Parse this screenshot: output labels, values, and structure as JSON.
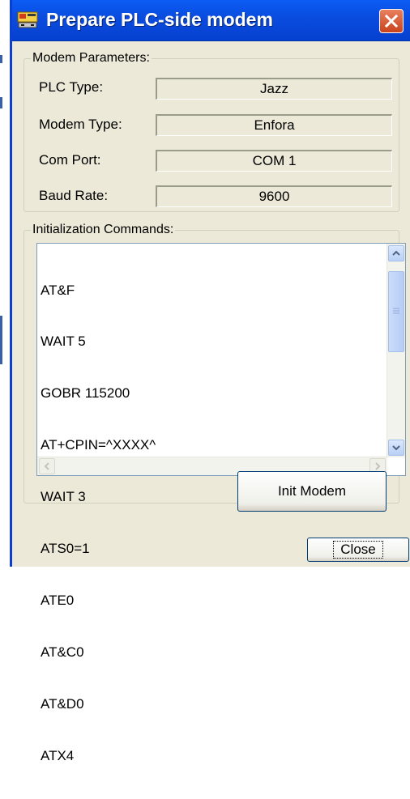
{
  "dialog": {
    "title": "Prepare PLC-side modem",
    "close_x": "close"
  },
  "modem_params": {
    "legend": "Modem Parameters:",
    "rows": [
      {
        "label": "PLC Type:",
        "value": "Jazz"
      },
      {
        "label": "Modem Type:",
        "value": "Enfora"
      },
      {
        "label": "Com Port:",
        "value": "COM 1"
      },
      {
        "label": "Baud Rate:",
        "value": "9600"
      }
    ]
  },
  "init": {
    "legend": "Initialization Commands:",
    "commands": [
      "AT&F",
      "WAIT 5",
      "GOBR 115200",
      "AT+CPIN=^XXXX^",
      "WAIT 3",
      "ATS0=1",
      "ATE0",
      "AT&C0",
      "AT&D0",
      "ATX4"
    ]
  },
  "buttons": {
    "init_modem": "Init Modem",
    "close": "Close"
  },
  "colors": {
    "titlebar": "#0a4de0",
    "dialog_bg": "#ece9d8",
    "close_x": "#c8431c"
  }
}
